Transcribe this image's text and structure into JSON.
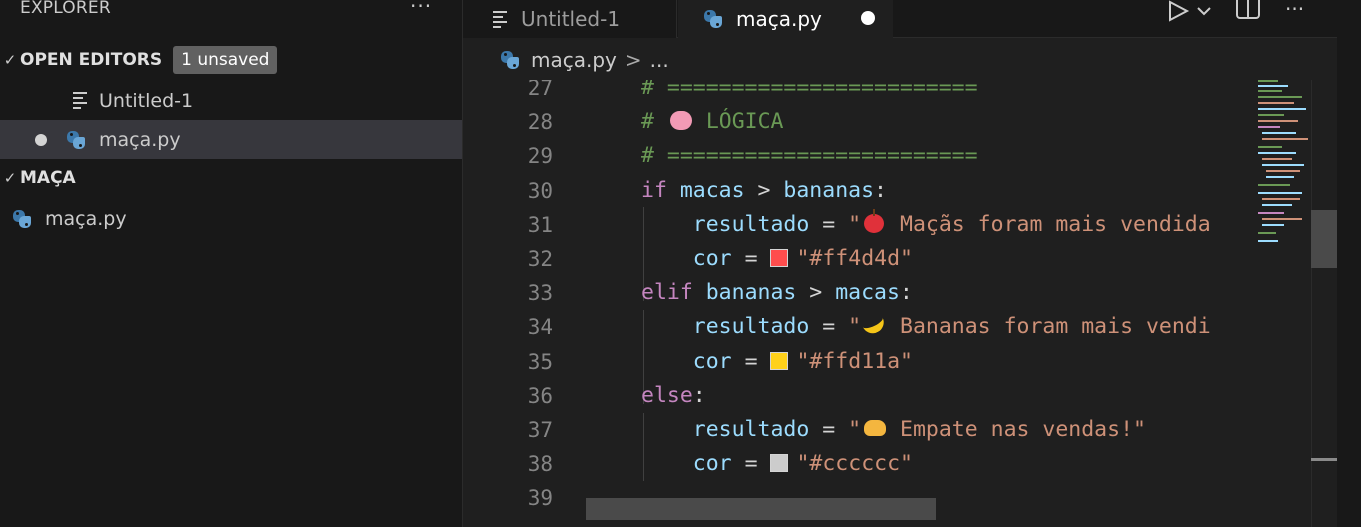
{
  "sidebar": {
    "title": "EXPLORER",
    "more": "···",
    "open_editors": {
      "label": "OPEN EDITORS",
      "badge": "1 unsaved",
      "items": [
        {
          "label": "Untitled-1",
          "icon": "text-file-icon"
        },
        {
          "label": "maça.py",
          "icon": "python-icon",
          "unsaved": true
        }
      ]
    },
    "folder": {
      "label": "MAÇA",
      "items": [
        {
          "label": "maça.py",
          "icon": "python-icon"
        }
      ]
    }
  },
  "tabs": [
    {
      "label": "Untitled-1",
      "active": false,
      "icon": "text-file-icon"
    },
    {
      "label": "maça.py",
      "active": true,
      "icon": "python-icon",
      "unsaved": true
    }
  ],
  "breadcrumb": {
    "file": "maça.py",
    "sep": ">",
    "rest": "..."
  },
  "editor": {
    "line_numbers": [
      "27",
      "28",
      "29",
      "30",
      "31",
      "32",
      "33",
      "34",
      "35",
      "36",
      "37",
      "38",
      "39"
    ],
    "lines": {
      "l27": "# ========================",
      "l28_hash": "# ",
      "l28_text": " LÓGICA",
      "l29": "# ========================",
      "l30_if": "if",
      "l30_a": "macas",
      "l30_op": " > ",
      "l30_b": "bananas",
      "l30_colon": ":",
      "res": "resultado",
      "eq": " = ",
      "cor": "cor",
      "l31_str_q": "\"",
      "l31_str": " Maçãs foram mais vendida",
      "l32_str": "\"#ff4d4d\"",
      "l33_elif": "elif",
      "l33_a": "bananas",
      "l33_op": " > ",
      "l33_b": "macas",
      "l34_str": " Bananas foram mais vendi",
      "l35_str": "\"#ffd11a\"",
      "l36_else": "else",
      "l37_str": " Empate nas vendas!\"",
      "l38_str": "\"#cccccc\""
    },
    "swatch_colors": [
      "#ff4d4d",
      "#ffd11a",
      "#cccccc"
    ]
  }
}
